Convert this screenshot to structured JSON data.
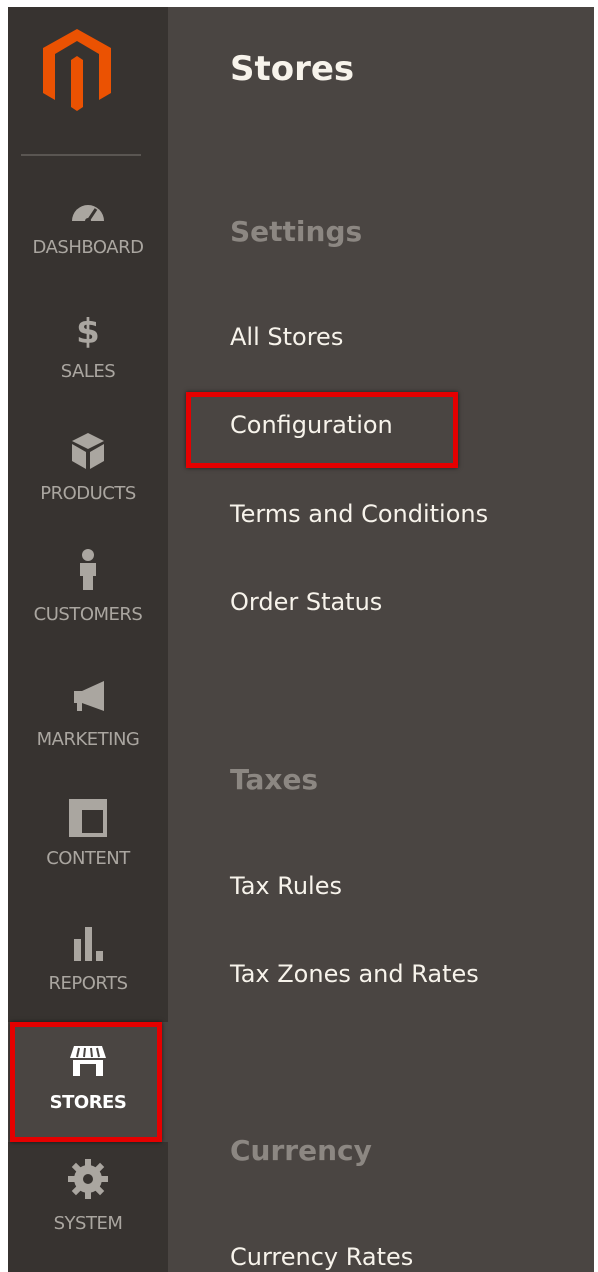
{
  "brand": {
    "logo_color": "#eb5202"
  },
  "nav": {
    "items": [
      {
        "id": "dashboard",
        "label": "DASHBOARD",
        "icon": "dashboard-gauge-icon"
      },
      {
        "id": "sales",
        "label": "SALES",
        "icon": "dollar-icon"
      },
      {
        "id": "products",
        "label": "PRODUCTS",
        "icon": "box-icon"
      },
      {
        "id": "customers",
        "label": "CUSTOMERS",
        "icon": "person-icon"
      },
      {
        "id": "marketing",
        "label": "MARKETING",
        "icon": "megaphone-icon"
      },
      {
        "id": "content",
        "label": "CONTENT",
        "icon": "layout-icon"
      },
      {
        "id": "reports",
        "label": "REPORTS",
        "icon": "bar-chart-icon"
      },
      {
        "id": "stores",
        "label": "STORES",
        "icon": "storefront-icon",
        "active": true
      },
      {
        "id": "system",
        "label": "SYSTEM",
        "icon": "gear-icon"
      }
    ]
  },
  "panel": {
    "title": "Stores",
    "sections": [
      {
        "title": "Settings",
        "links": [
          "All Stores",
          "Configuration",
          "Terms and Conditions",
          "Order Status"
        ]
      },
      {
        "title": "Taxes",
        "links": [
          "Tax Rules",
          "Tax Zones and Rates"
        ]
      },
      {
        "title": "Currency",
        "links": [
          "Currency Rates"
        ]
      }
    ]
  },
  "highlight_color": "#e50000"
}
